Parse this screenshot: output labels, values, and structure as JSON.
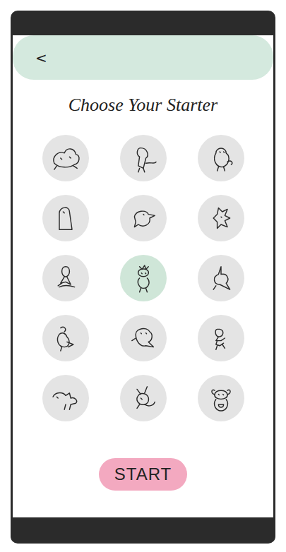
{
  "header": {
    "back": "<"
  },
  "title": "Choose Your Starter",
  "starters": [
    {
      "selected": false
    },
    {
      "selected": false
    },
    {
      "selected": false
    },
    {
      "selected": false
    },
    {
      "selected": false
    },
    {
      "selected": false
    },
    {
      "selected": false
    },
    {
      "selected": true
    },
    {
      "selected": false
    },
    {
      "selected": false
    },
    {
      "selected": false
    },
    {
      "selected": false
    },
    {
      "selected": false
    },
    {
      "selected": false
    },
    {
      "selected": false
    }
  ],
  "button": "START"
}
